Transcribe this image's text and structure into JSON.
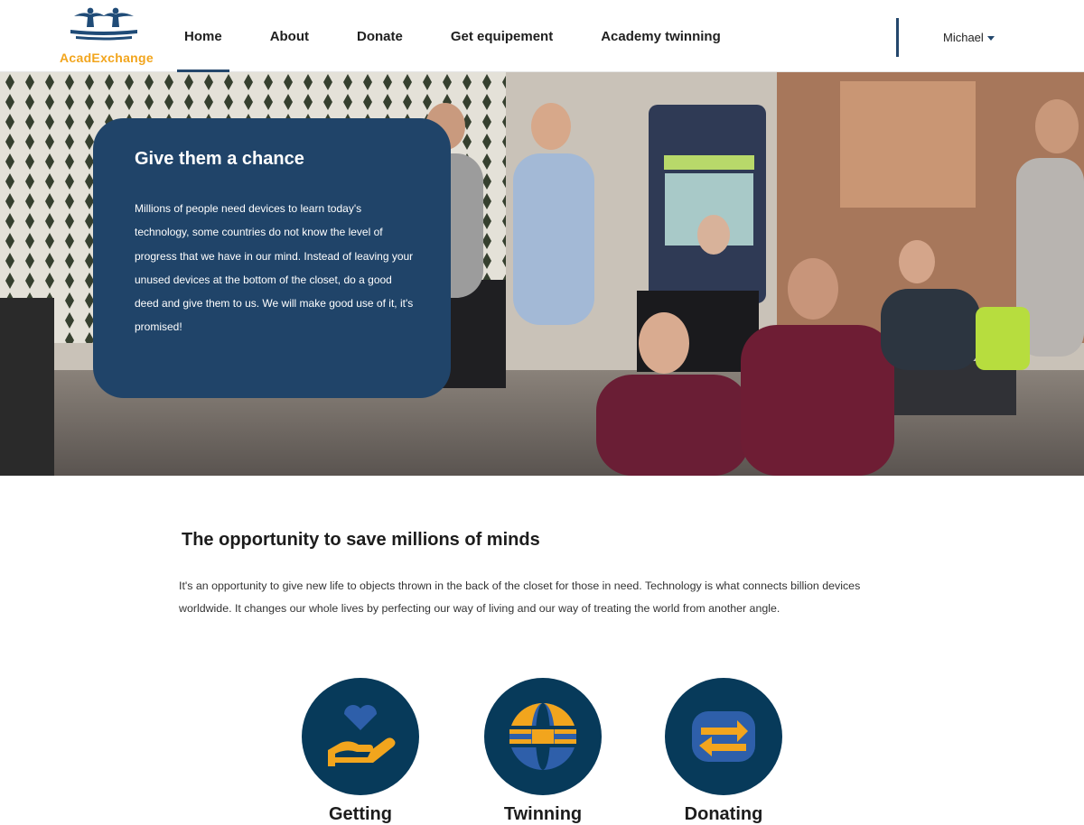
{
  "brand": {
    "name": "AcadExchange"
  },
  "nav": {
    "items": [
      {
        "label": "Home"
      },
      {
        "label": "About"
      },
      {
        "label": "Donate"
      },
      {
        "label": "Get equipement"
      },
      {
        "label": "Academy twinning"
      }
    ],
    "active": "Home"
  },
  "user": {
    "name": "Michael"
  },
  "hero": {
    "title": "Give them a chance",
    "text": "Millions of people need devices to learn today's technology, some countries do not know the level of progress that we have in our mind. Instead of leaving your unused devices at the bottom of the closet, do a good deed and give them to us. We will make good use of it, it's promised!"
  },
  "opportunity": {
    "title": "The opportunity to save millions of minds",
    "text": "It's an opportunity to give new life to objects thrown in the back of the closet for those in need. Technology is what connects billion devices worldwide. It changes our whole lives by perfecting our way of living and our way of treating the world from another angle."
  },
  "features": [
    {
      "icon": "heart-in-hand-icon",
      "label": "Getting"
    },
    {
      "icon": "globe-icon",
      "label": "Twinning"
    },
    {
      "icon": "exchange-arrows-icon",
      "label": "Donating"
    }
  ],
  "colors": {
    "brand_blue": "#204469",
    "feature_navy": "#073a5a",
    "accent_orange": "#f2a51d",
    "icon_blue": "#2e5faa",
    "logo_text": "#f2a51d"
  }
}
